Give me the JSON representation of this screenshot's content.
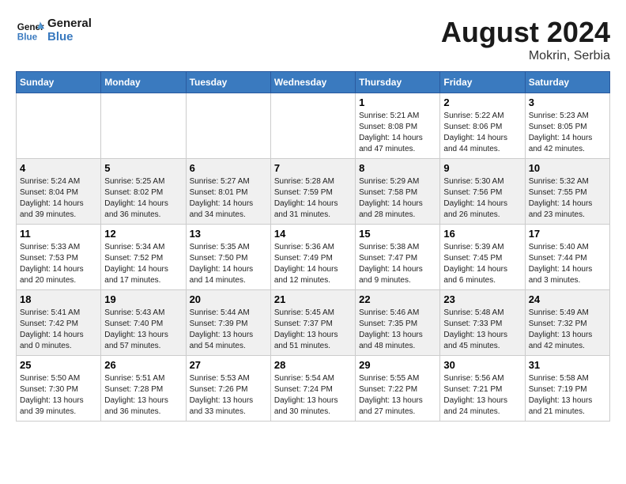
{
  "header": {
    "logo_line1": "General",
    "logo_line2": "Blue",
    "month_year": "August 2024",
    "location": "Mokrin, Serbia"
  },
  "weekdays": [
    "Sunday",
    "Monday",
    "Tuesday",
    "Wednesday",
    "Thursday",
    "Friday",
    "Saturday"
  ],
  "weeks": [
    [
      {
        "day": "",
        "info": ""
      },
      {
        "day": "",
        "info": ""
      },
      {
        "day": "",
        "info": ""
      },
      {
        "day": "",
        "info": ""
      },
      {
        "day": "1",
        "info": "Sunrise: 5:21 AM\nSunset: 8:08 PM\nDaylight: 14 hours\nand 47 minutes."
      },
      {
        "day": "2",
        "info": "Sunrise: 5:22 AM\nSunset: 8:06 PM\nDaylight: 14 hours\nand 44 minutes."
      },
      {
        "day": "3",
        "info": "Sunrise: 5:23 AM\nSunset: 8:05 PM\nDaylight: 14 hours\nand 42 minutes."
      }
    ],
    [
      {
        "day": "4",
        "info": "Sunrise: 5:24 AM\nSunset: 8:04 PM\nDaylight: 14 hours\nand 39 minutes."
      },
      {
        "day": "5",
        "info": "Sunrise: 5:25 AM\nSunset: 8:02 PM\nDaylight: 14 hours\nand 36 minutes."
      },
      {
        "day": "6",
        "info": "Sunrise: 5:27 AM\nSunset: 8:01 PM\nDaylight: 14 hours\nand 34 minutes."
      },
      {
        "day": "7",
        "info": "Sunrise: 5:28 AM\nSunset: 7:59 PM\nDaylight: 14 hours\nand 31 minutes."
      },
      {
        "day": "8",
        "info": "Sunrise: 5:29 AM\nSunset: 7:58 PM\nDaylight: 14 hours\nand 28 minutes."
      },
      {
        "day": "9",
        "info": "Sunrise: 5:30 AM\nSunset: 7:56 PM\nDaylight: 14 hours\nand 26 minutes."
      },
      {
        "day": "10",
        "info": "Sunrise: 5:32 AM\nSunset: 7:55 PM\nDaylight: 14 hours\nand 23 minutes."
      }
    ],
    [
      {
        "day": "11",
        "info": "Sunrise: 5:33 AM\nSunset: 7:53 PM\nDaylight: 14 hours\nand 20 minutes."
      },
      {
        "day": "12",
        "info": "Sunrise: 5:34 AM\nSunset: 7:52 PM\nDaylight: 14 hours\nand 17 minutes."
      },
      {
        "day": "13",
        "info": "Sunrise: 5:35 AM\nSunset: 7:50 PM\nDaylight: 14 hours\nand 14 minutes."
      },
      {
        "day": "14",
        "info": "Sunrise: 5:36 AM\nSunset: 7:49 PM\nDaylight: 14 hours\nand 12 minutes."
      },
      {
        "day": "15",
        "info": "Sunrise: 5:38 AM\nSunset: 7:47 PM\nDaylight: 14 hours\nand 9 minutes."
      },
      {
        "day": "16",
        "info": "Sunrise: 5:39 AM\nSunset: 7:45 PM\nDaylight: 14 hours\nand 6 minutes."
      },
      {
        "day": "17",
        "info": "Sunrise: 5:40 AM\nSunset: 7:44 PM\nDaylight: 14 hours\nand 3 minutes."
      }
    ],
    [
      {
        "day": "18",
        "info": "Sunrise: 5:41 AM\nSunset: 7:42 PM\nDaylight: 14 hours\nand 0 minutes."
      },
      {
        "day": "19",
        "info": "Sunrise: 5:43 AM\nSunset: 7:40 PM\nDaylight: 13 hours\nand 57 minutes."
      },
      {
        "day": "20",
        "info": "Sunrise: 5:44 AM\nSunset: 7:39 PM\nDaylight: 13 hours\nand 54 minutes."
      },
      {
        "day": "21",
        "info": "Sunrise: 5:45 AM\nSunset: 7:37 PM\nDaylight: 13 hours\nand 51 minutes."
      },
      {
        "day": "22",
        "info": "Sunrise: 5:46 AM\nSunset: 7:35 PM\nDaylight: 13 hours\nand 48 minutes."
      },
      {
        "day": "23",
        "info": "Sunrise: 5:48 AM\nSunset: 7:33 PM\nDaylight: 13 hours\nand 45 minutes."
      },
      {
        "day": "24",
        "info": "Sunrise: 5:49 AM\nSunset: 7:32 PM\nDaylight: 13 hours\nand 42 minutes."
      }
    ],
    [
      {
        "day": "25",
        "info": "Sunrise: 5:50 AM\nSunset: 7:30 PM\nDaylight: 13 hours\nand 39 minutes."
      },
      {
        "day": "26",
        "info": "Sunrise: 5:51 AM\nSunset: 7:28 PM\nDaylight: 13 hours\nand 36 minutes."
      },
      {
        "day": "27",
        "info": "Sunrise: 5:53 AM\nSunset: 7:26 PM\nDaylight: 13 hours\nand 33 minutes."
      },
      {
        "day": "28",
        "info": "Sunrise: 5:54 AM\nSunset: 7:24 PM\nDaylight: 13 hours\nand 30 minutes."
      },
      {
        "day": "29",
        "info": "Sunrise: 5:55 AM\nSunset: 7:22 PM\nDaylight: 13 hours\nand 27 minutes."
      },
      {
        "day": "30",
        "info": "Sunrise: 5:56 AM\nSunset: 7:21 PM\nDaylight: 13 hours\nand 24 minutes."
      },
      {
        "day": "31",
        "info": "Sunrise: 5:58 AM\nSunset: 7:19 PM\nDaylight: 13 hours\nand 21 minutes."
      }
    ]
  ]
}
